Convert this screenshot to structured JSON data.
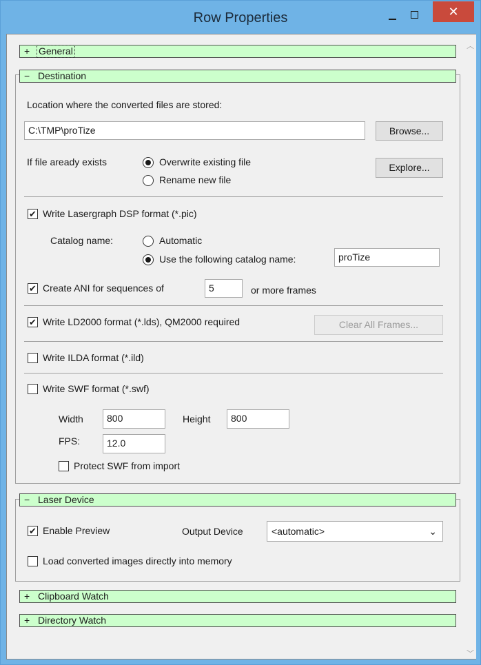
{
  "window": {
    "title": "Row Properties",
    "close_glyph": "✕"
  },
  "sections": {
    "general": {
      "sign": "+",
      "label": "General"
    },
    "destination": {
      "sign": "−",
      "label": "Destination"
    },
    "laser_device": {
      "sign": "−",
      "label": "Laser Device"
    },
    "clipboard_watch": {
      "sign": "+",
      "label": "Clipboard Watch"
    },
    "directory_watch": {
      "sign": "+",
      "label": "Directory Watch"
    }
  },
  "destination": {
    "location_label": "Location where the converted files are stored:",
    "path_value": "C:\\TMP\\proTize",
    "browse_label": "Browse...",
    "explore_label": "Explore...",
    "if_exists_label": "If file aready exists",
    "overwrite_label": "Overwrite existing file",
    "rename_label": "Rename new file",
    "write_dsp_label": "Write Lasergraph DSP format (*.pic)",
    "catalog_name_label": "Catalog name:",
    "automatic_label": "Automatic",
    "use_following_label": "Use the following catalog name:",
    "catalog_name_value": "proTize",
    "create_ani_label": "Create ANI for sequences of",
    "ani_frames_value": "5",
    "or_more_frames_label": "or more frames",
    "write_ld2000_label": "Write LD2000 format (*.lds), QM2000 required",
    "clear_all_frames_label": "Clear All Frames...",
    "write_ilda_label": "Write ILDA format (*.ild)",
    "write_swf_label": "Write SWF format (*.swf)",
    "width_label": "Width",
    "width_value": "800",
    "height_label": "Height",
    "height_value": "800",
    "fps_label": "FPS:",
    "fps_value": "12.0",
    "protect_swf_label": "Protect SWF from import"
  },
  "laser_device": {
    "enable_preview_label": "Enable Preview",
    "output_device_label": "Output Device",
    "output_device_value": "<automatic>",
    "load_into_memory_label": "Load converted images directly into memory"
  },
  "checkbox_glyph": "✔",
  "colors": {
    "section_header": "#ccffcc",
    "title_bar": "#6fb3e6",
    "close_button": "#c94a3c"
  }
}
